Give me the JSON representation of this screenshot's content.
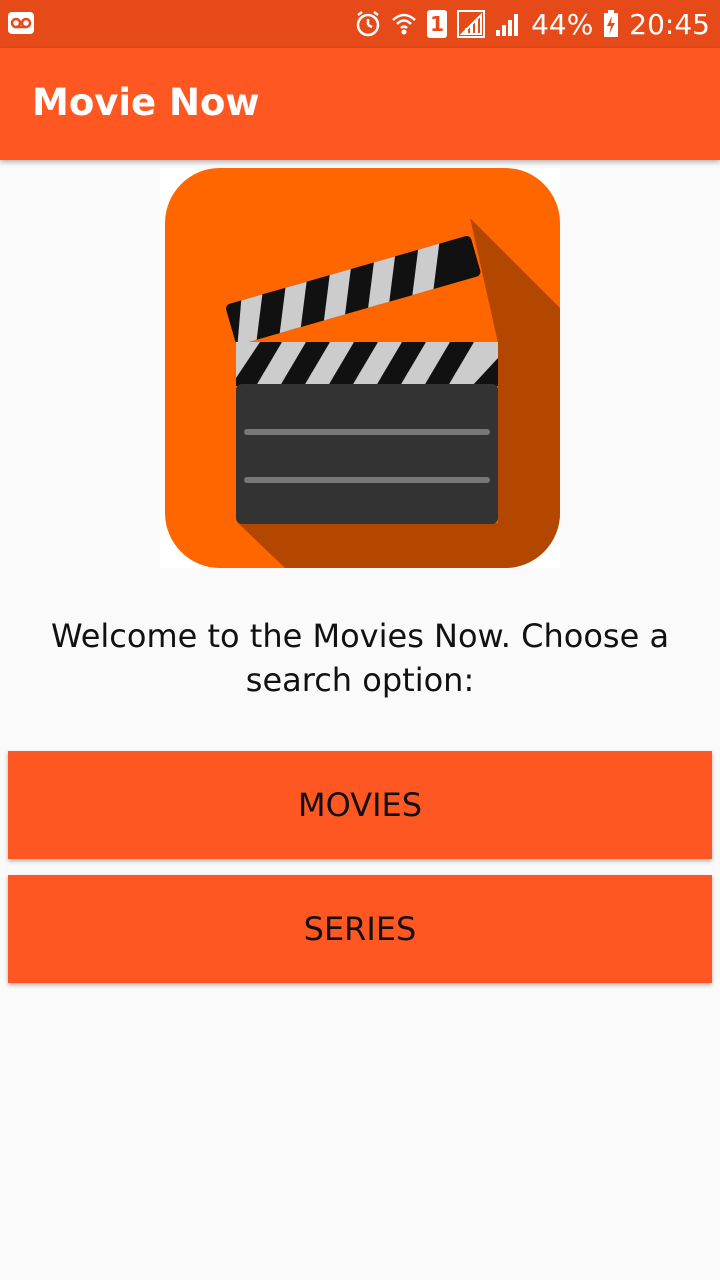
{
  "status_bar": {
    "battery": "44%",
    "time": "20:45",
    "sim_slot": "1",
    "icons": [
      "voicemail-icon",
      "alarm-icon",
      "wifi-icon",
      "sim-1-icon",
      "signal-icon",
      "signal-icon",
      "battery-charging-icon"
    ]
  },
  "app_bar": {
    "title": "Movie Now"
  },
  "main": {
    "logo_icon": "clapperboard-icon",
    "welcome": "Welcome to the Movies Now. Choose a search option:",
    "buttons": {
      "movies": "MOVIES",
      "series": "SERIES"
    }
  },
  "colors": {
    "status_bar": "#e64a19",
    "accent": "#ff5722",
    "logo_bg": "#ff6600",
    "logo_shadow": "#b34700",
    "clapper_body": "#333333"
  }
}
